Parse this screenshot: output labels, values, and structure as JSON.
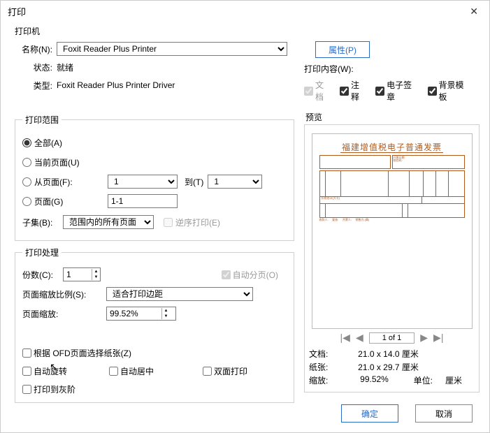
{
  "window": {
    "title": "打印"
  },
  "printer": {
    "heading": "打印机",
    "nameLabel": "名称(N):",
    "nameValue": "Foxit Reader Plus Printer",
    "statusLabel": "状态:",
    "statusValue": "就绪",
    "typeLabel": "类型:",
    "typeValue": "Foxit Reader Plus Printer Driver",
    "propertiesBtn": "属性(P)"
  },
  "content": {
    "label": "打印内容(W):",
    "docLabel": "文档",
    "annotLabel": "注释",
    "sigLabel": "电子签章",
    "bgLabel": "背景模板"
  },
  "range": {
    "legend": "打印范围",
    "all": "全部(A)",
    "current": "当前页面(U)",
    "from": "从页面(F):",
    "fromVal": "1",
    "toLabel": "到(T)",
    "toVal": "1",
    "pages": "页面(G)",
    "pagesVal": "1-1",
    "subsetLabel": "子集(B):",
    "subsetVal": "范围内的所有页面",
    "reverse": "逆序打印(E)"
  },
  "handling": {
    "legend": "打印处理",
    "copiesLabel": "份数(C):",
    "copiesVal": "1",
    "collate": "自动分页(O)",
    "scaleLabel": "页面缩放比例(S):",
    "scaleVal": "适合打印边距",
    "zoomLabel": "页面缩放:",
    "zoomVal": "99.52%",
    "paperByOfd": "根据 OFD页面选择纸张(Z)",
    "autoRotate": "自动旋转",
    "autoCenter": "自动居中",
    "duplex": "双面打印",
    "grayscale": "打印到灰阶"
  },
  "preview": {
    "label": "预览",
    "invoiceTitle": "福建增值税电子普通发票",
    "pageIndicator": "1 of 1",
    "docLabel": "文档:",
    "docSize": "21.0 x 14.0 厘米",
    "paperLabel": "纸张:",
    "paperSize": "21.0 x 29.7 厘米",
    "zoomLabel": "缩放:",
    "zoomVal": "99.52%",
    "unitLabel": "单位:",
    "unitVal": "厘米"
  },
  "footer": {
    "ok": "确定",
    "cancel": "取消"
  }
}
